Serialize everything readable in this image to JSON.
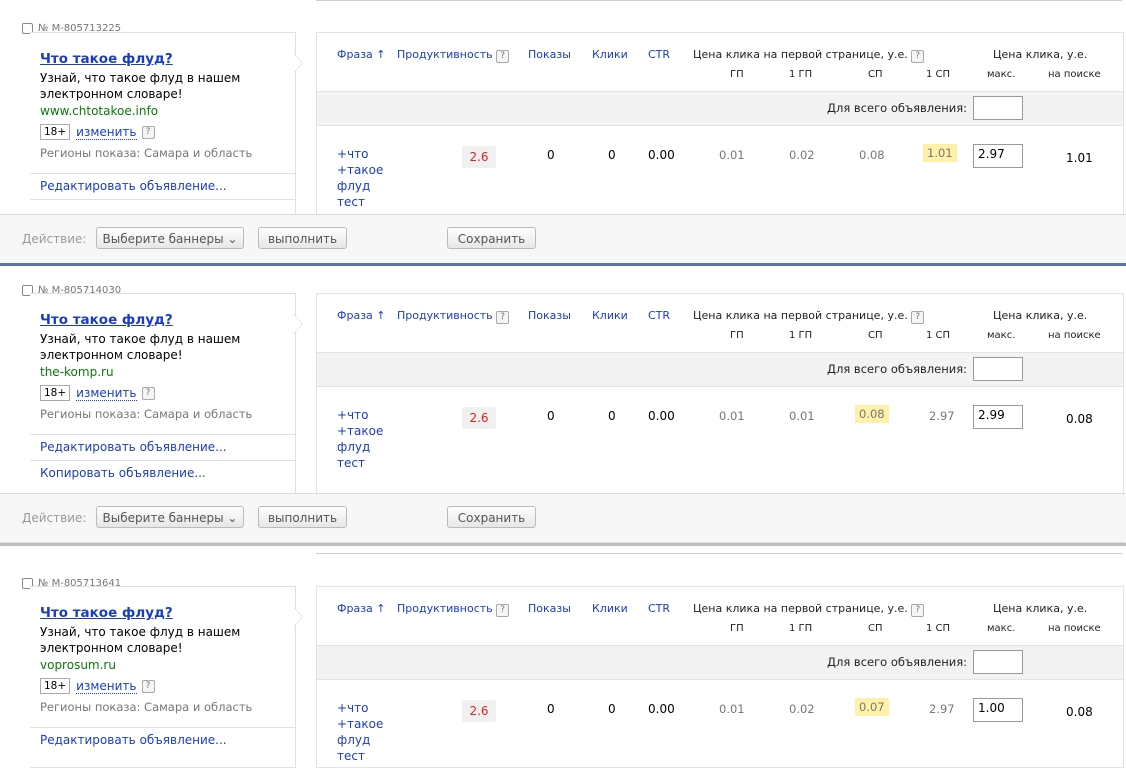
{
  "columns": {
    "phrase": "Фраза",
    "sort_arrow": "↑",
    "productivity": "Продуктивность",
    "impressions": "Показы",
    "clicks": "Клики",
    "ctr": "CTR",
    "first_page_price": "Цена клика на первой странице, у.е.",
    "gp": "ГП",
    "first_gp": "1 ГП",
    "sp": "СП",
    "first_sp": "1 СП",
    "click_price": "Цена клика, у.е.",
    "max": "макс.",
    "on_search": "на поиске",
    "help": "?"
  },
  "whole_ad_label": "Для всего объявления:",
  "action_bar": {
    "label": "Действие:",
    "select_banners": "Выберите баннеры",
    "select_arrow": "⌄",
    "execute": "выполнить",
    "save": "Сохранить"
  },
  "ads": [
    {
      "id": "№ M-805713225",
      "title": "Что такое флуд?",
      "text": "Узнай, что такое флуд в нашем электронном словаре!",
      "url": "www.chtotakoe.info",
      "age": "18+",
      "change": "изменить",
      "regions": "Регионы показа: Самара и область",
      "links": [
        "Редактировать объявление..."
      ],
      "phrase": [
        "+что",
        "+такое",
        "флуд",
        "тест"
      ],
      "productivity": "2.6",
      "impressions": "0",
      "clicks": "0",
      "ctr": "0.00",
      "gp": "0.01",
      "first_gp": "0.02",
      "sp": "0.08",
      "first_sp": "1.01",
      "max": "2.97",
      "on_search": "1.01"
    },
    {
      "id": "№ M-805714030",
      "title": "Что такое флуд?",
      "text": "Узнай, что такое флуд в нашем электронном словаре!",
      "url": "the-komp.ru",
      "age": "18+",
      "change": "изменить",
      "regions": "Регионы показа: Самара и область",
      "links": [
        "Редактировать объявление...",
        "Копировать объявление..."
      ],
      "phrase": [
        "+что",
        "+такое",
        "флуд",
        "тест"
      ],
      "productivity": "2.6",
      "impressions": "0",
      "clicks": "0",
      "ctr": "0.00",
      "gp": "0.01",
      "first_gp": "0.01",
      "sp": "0.08",
      "first_sp": "2.97",
      "max": "2.99",
      "on_search": "0.08"
    },
    {
      "id": "№ M-805713641",
      "title": "Что такое флуд?",
      "text": "Узнай, что такое флуд в нашем электронном словаре!",
      "url": "voprosum.ru",
      "age": "18+",
      "change": "изменить",
      "regions": "Регионы показа: Самара и область",
      "links": [
        "Редактировать объявление..."
      ],
      "phrase": [
        "+что",
        "+такое",
        "флуд",
        "тест"
      ],
      "productivity": "2.6",
      "impressions": "0",
      "clicks": "0",
      "ctr": "0.00",
      "gp": "0.01",
      "first_gp": "0.02",
      "sp": "0.07",
      "first_sp": "2.97",
      "max": "1.00",
      "on_search": "0.08"
    }
  ]
}
